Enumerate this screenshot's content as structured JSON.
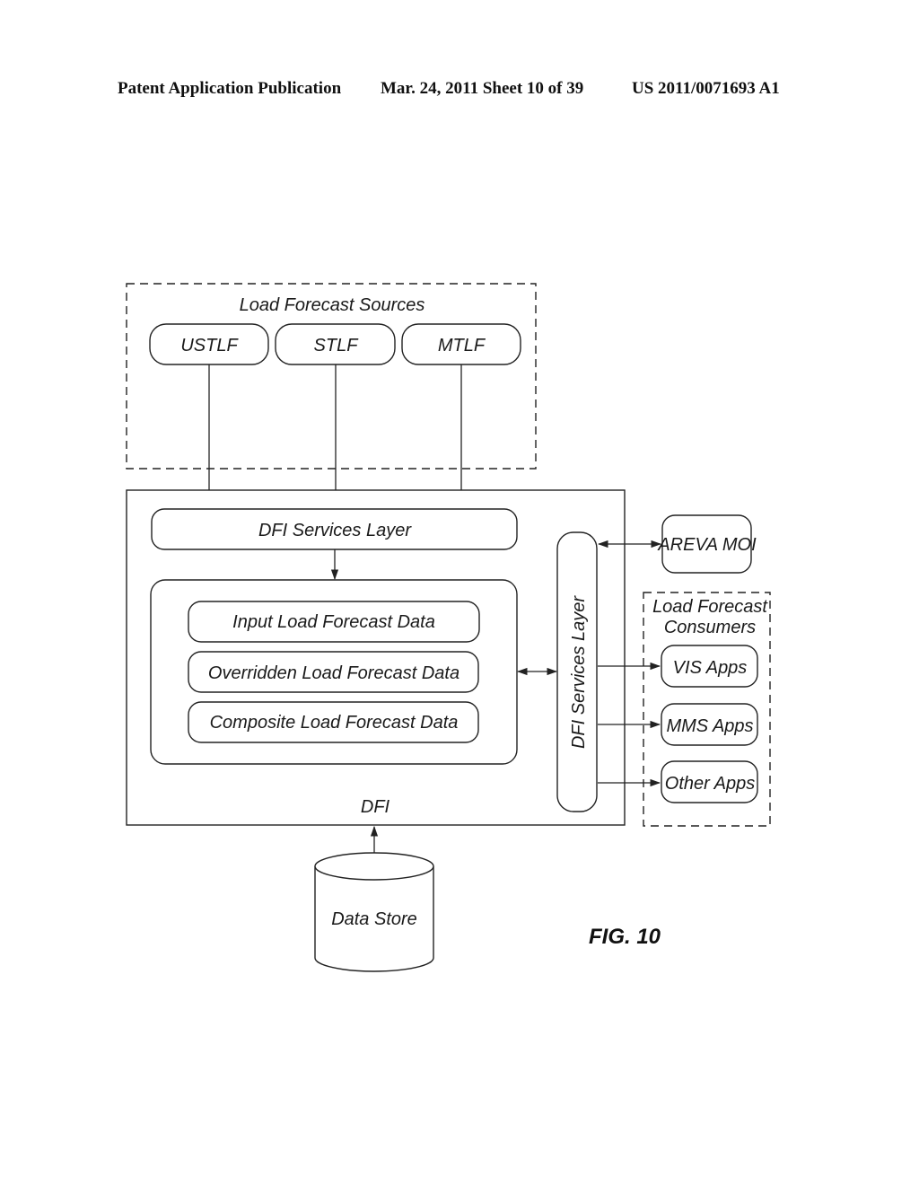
{
  "header": {
    "publication": "Patent Application Publication",
    "date_sheet": "Mar. 24, 2011  Sheet 10 of 39",
    "number": "US 2011/0071693 A1"
  },
  "diagram": {
    "sources_group": {
      "label": "Load Forecast Sources",
      "items": [
        "USTLF",
        "STLF",
        "MTLF"
      ]
    },
    "dfi": {
      "label": "DFI",
      "services_layer_top": "DFI Services Layer",
      "services_layer_side": "DFI Services Layer",
      "data_items": [
        "Input Load Forecast Data",
        "Overridden Load Forecast Data",
        "Composite Load Forecast Data"
      ]
    },
    "areva": "AREVA MOI",
    "consumers_group": {
      "label_line1": "Load Forecast",
      "label_line2": "Consumers",
      "items": [
        "VIS Apps",
        "MMS Apps",
        "Other Apps"
      ]
    },
    "data_store": "Data Store",
    "figure_label": "FIG. 10"
  }
}
